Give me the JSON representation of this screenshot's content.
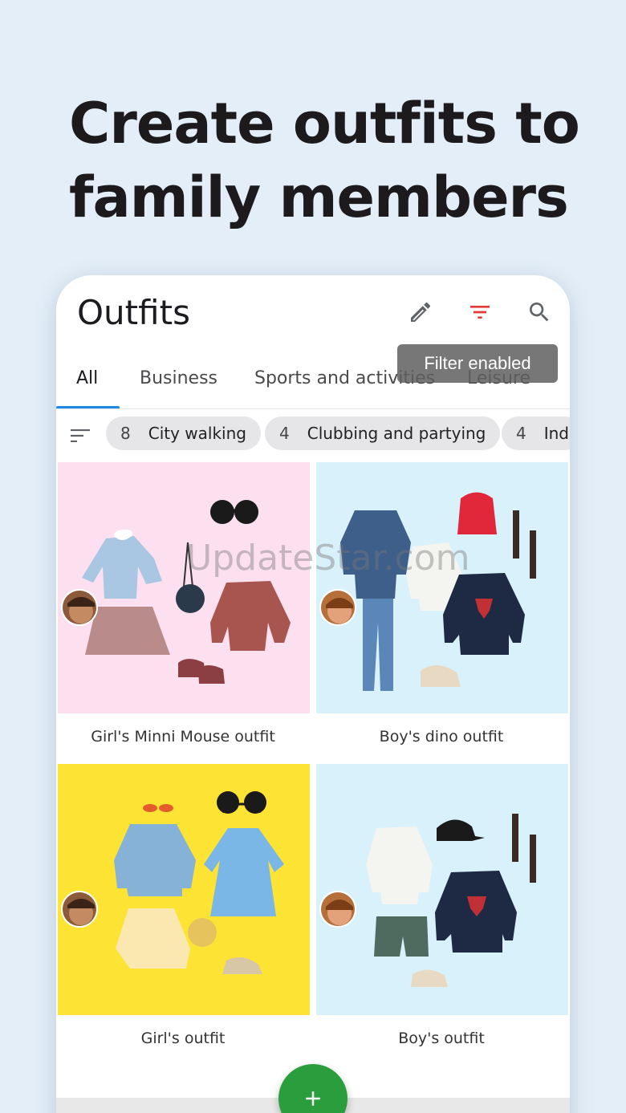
{
  "headline": {
    "line1": "Create outfits to",
    "line2": "family members"
  },
  "app": {
    "title": "Outfits",
    "icons": [
      "pencil-icon",
      "filter-icon",
      "search-icon"
    ],
    "tooltip": "Filter enabled",
    "accent_color": "#e53935"
  },
  "tabs": [
    {
      "label": "All",
      "active": true
    },
    {
      "label": "Business",
      "active": false
    },
    {
      "label": "Sports and activities",
      "active": false
    },
    {
      "label": "Leisure",
      "active": false
    }
  ],
  "chips": [
    {
      "count": "8",
      "label": "City walking"
    },
    {
      "count": "4",
      "label": "Clubbing and partying"
    },
    {
      "count": "4",
      "label": "Ind"
    }
  ],
  "outfits": [
    {
      "caption": "Girl's Minni Mouse outfit",
      "bg": "#fde0ef"
    },
    {
      "caption": "Boy's dino outfit",
      "bg": "#d9f1fb"
    },
    {
      "caption": "Girl's outfit",
      "bg": "#fde334"
    },
    {
      "caption": "Boy's outfit",
      "bg": "#d9f1fb"
    }
  ],
  "watermark": "UpdateStar.com",
  "fab_icon": "plus-icon"
}
